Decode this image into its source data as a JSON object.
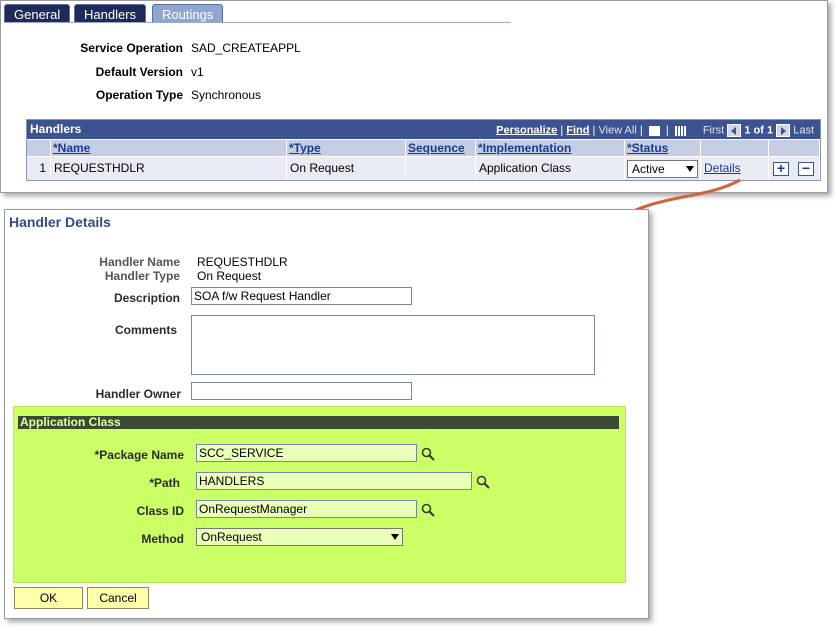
{
  "tabs": [
    {
      "label": "General",
      "state": "inactive-dark"
    },
    {
      "label": "Handlers",
      "state": "active"
    },
    {
      "label": "Routings",
      "state": "inactive"
    }
  ],
  "service_info": {
    "service_operation_label": "Service Operation",
    "service_operation_value": "SAD_CREATEAPPL",
    "default_version_label": "Default Version",
    "default_version_value": "v1",
    "operation_type_label": "Operation Type",
    "operation_type_value": "Synchronous"
  },
  "handlers_grid": {
    "title": "Handlers",
    "nav": {
      "personalize": "Personalize",
      "find": "Find",
      "view_all": "View All",
      "first": "First",
      "range": "1 of 1",
      "last": "Last"
    },
    "columns": [
      "*Name",
      "*Type",
      "Sequence",
      "*Implementation",
      "*Status"
    ],
    "rows": [
      {
        "index": "1",
        "name": "REQUESTHDLR",
        "type": "On Request",
        "sequence": "",
        "implementation": "Application Class",
        "status": "Active",
        "details": "Details"
      }
    ]
  },
  "handler_details": {
    "title": "Handler Details",
    "handler_name_label": "Handler Name",
    "handler_name_value": "REQUESTHDLR",
    "handler_type_label": "Handler Type",
    "handler_type_value": "On Request",
    "description_label": "Description",
    "description_value": "SOA f/w Request Handler",
    "comments_label": "Comments",
    "comments_value": "",
    "handler_owner_label": "Handler Owner",
    "handler_owner_value": "",
    "application_class": {
      "header": "Application Class",
      "package_name_label": "*Package Name",
      "package_name_value": "SCC_SERVICE",
      "path_label": "*Path",
      "path_value": "HANDLERS",
      "class_id_label": "Class ID",
      "class_id_value": "OnRequestManager",
      "method_label": "Method",
      "method_value": "OnRequest"
    },
    "ok_label": "OK",
    "cancel_label": "Cancel"
  },
  "colors": {
    "grid_header": "#3c5291",
    "app_class_bg": "#ccff66",
    "callout_arrow": "#d2643c"
  }
}
